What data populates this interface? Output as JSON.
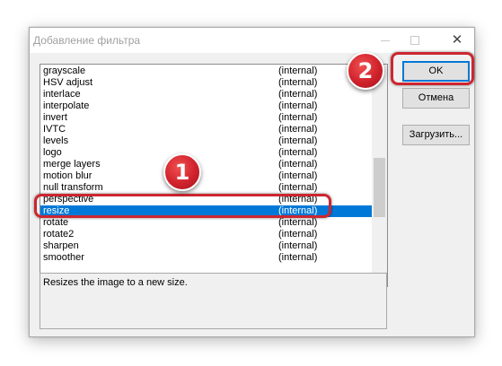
{
  "window": {
    "title": "Добавление фильтра",
    "minimize_icon": "minimize-icon",
    "maximize_icon": "maximize-icon",
    "close_glyph": "✕"
  },
  "filter_list": {
    "items": [
      {
        "name": "grayscale",
        "source": "(internal)"
      },
      {
        "name": "HSV adjust",
        "source": "(internal)"
      },
      {
        "name": "interlace",
        "source": "(internal)"
      },
      {
        "name": "interpolate",
        "source": "(internal)"
      },
      {
        "name": "invert",
        "source": "(internal)"
      },
      {
        "name": "IVTC",
        "source": "(internal)"
      },
      {
        "name": "levels",
        "source": "(internal)"
      },
      {
        "name": "logo",
        "source": "(internal)"
      },
      {
        "name": "merge layers",
        "source": "(internal)"
      },
      {
        "name": "motion blur",
        "source": "(internal)"
      },
      {
        "name": "null transform",
        "source": "(internal)"
      },
      {
        "name": "perspective",
        "source": "(internal)"
      },
      {
        "name": "resize",
        "source": "(internal)"
      },
      {
        "name": "rotate",
        "source": "(internal)"
      },
      {
        "name": "rotate2",
        "source": "(internal)"
      },
      {
        "name": "sharpen",
        "source": "(internal)"
      },
      {
        "name": "smoother",
        "source": "(internal)"
      }
    ],
    "selected_index": 12,
    "scroll_up_glyph": "︿",
    "scroll_down_glyph": "﹀"
  },
  "description": "Resizes the image to a new size.",
  "buttons": {
    "ok": "OK",
    "cancel": "Отмена",
    "load": "Загрузить..."
  },
  "annotations": {
    "badge_1": "1",
    "badge_2": "2",
    "accent_color": "#cc2630"
  }
}
